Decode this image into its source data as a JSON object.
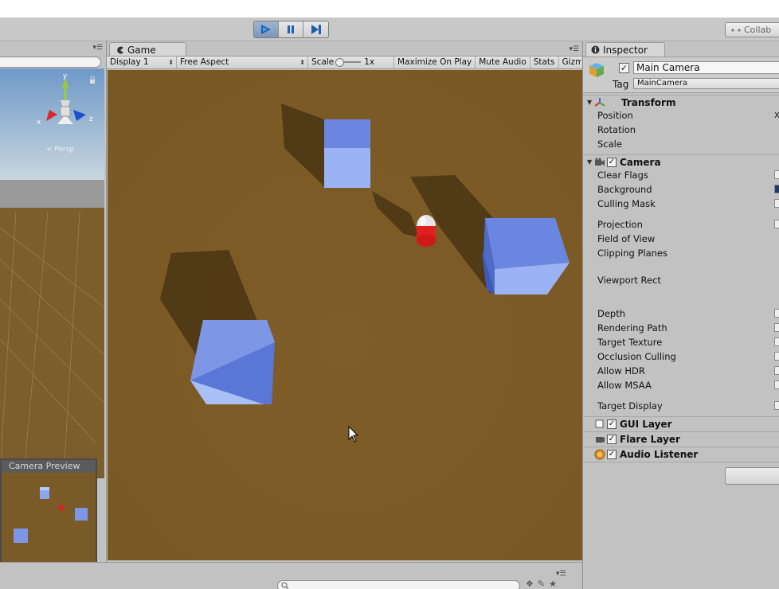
{
  "toolbar": {
    "play_icon": "play-icon",
    "pause_icon": "pause-icon",
    "step_icon": "step-icon",
    "collab_label": "Collab"
  },
  "scene": {
    "camera_preview_title": "Camera Preview",
    "gizmo_axes": {
      "x": "x",
      "y": "y",
      "z": "z"
    },
    "gizmo_label": "< Persp"
  },
  "game": {
    "tab_label": "Game",
    "display": "Display 1",
    "aspect": "Free Aspect",
    "scale_label": "Scale",
    "scale_value": "1x",
    "maximize_on_play": "Maximize On Play",
    "mute_audio": "Mute Audio",
    "stats": "Stats",
    "gizmos": "Gizmos"
  },
  "inspector": {
    "tab_label": "Inspector",
    "object_name": "Main Camera",
    "tag_label": "Tag",
    "tag_value": "MainCamera",
    "transform": {
      "title": "Transform",
      "props": [
        "Position",
        "Rotation",
        "Scale"
      ]
    },
    "camera": {
      "title": "Camera",
      "props": [
        "Clear Flags",
        "Background",
        "Culling Mask",
        "Projection",
        "Field of View",
        "Clipping Planes",
        "Viewport Rect",
        "Depth",
        "Rendering Path",
        "Target Texture",
        "Occlusion Culling",
        "Allow HDR",
        "Allow MSAA",
        "Target Display"
      ]
    },
    "components": [
      "GUI Layer",
      "Flare Layer",
      "Audio Listener"
    ]
  },
  "colors": {
    "ground": "#7a5a26",
    "cube": "#6f8be6",
    "capsule_red": "#e02020",
    "panel": "#c2c2c2",
    "sky": "#a9c7e2"
  }
}
